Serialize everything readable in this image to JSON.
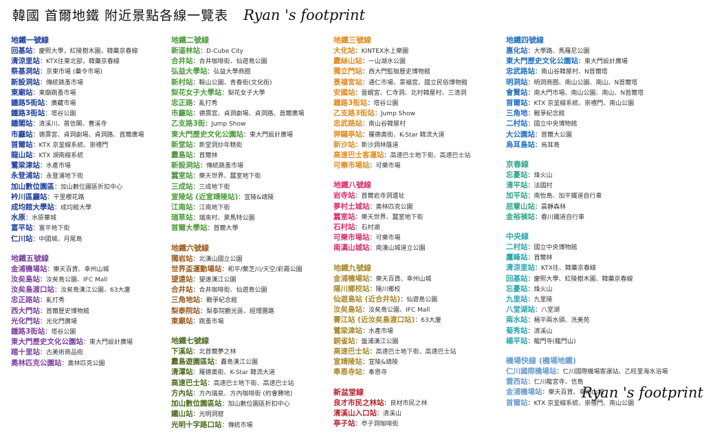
{
  "header": {
    "title": "韓國 首爾地鐵 附近景點各線一覽表",
    "signature": "Ryan 's footprint"
  },
  "footer": {
    "signature": "Ryan 's footprint"
  },
  "columns": [
    [
      {
        "title": "地鐵一號線",
        "color": "#1d3e9e",
        "items": [
          [
            "回基站",
            "慶熙大學，紅陵樹木園，韓藥京春線"
          ],
          [
            "清涼里站",
            "KTX往東北部，韓藥京春線"
          ],
          [
            "祭基洞站",
            "京東市場 (藥令市場)"
          ],
          [
            "新設洞站",
            "傳統跳蚤市場"
          ],
          [
            "東廟站",
            "東廟跳蚤市場"
          ],
          [
            "鍾路5街站",
            "廣藏市場"
          ],
          [
            "鍾路3街站",
            "塔谷公園"
          ],
          [
            "鍾閣站",
            "清溪川、普信閣、曹溪寺"
          ],
          [
            "市廳站",
            "德壽宮、貞洞劇場、貞洞路、首爾廣場"
          ],
          [
            "首爾站",
            "KTX 京釜線系統、崇禮門"
          ],
          [
            "龍山站",
            "KTX 湖南線系統"
          ],
          [
            "鷺梁津站",
            "水產市場"
          ],
          [
            "永登浦站",
            "永登浦地下街"
          ],
          [
            "加山數位園區",
            "加山數位園區折扣中心"
          ],
          [
            "衿川區廳站",
            "干里櫻花路"
          ],
          [
            "成均館大學站",
            "成均館大學"
          ],
          [
            "水原",
            "水原華城"
          ],
          [
            "富平站",
            "富平地下街"
          ],
          [
            "仁川站",
            "中國城、月尾島"
          ]
        ]
      },
      {
        "title": "地鐵五號線",
        "color": "#7b3fa0",
        "items": [
          [
            "金浦機場站",
            "樂天百貨、幸州山城"
          ],
          [
            "汝矣島站",
            "汝矣島公園、IFC Mall"
          ],
          [
            "汝矣島渡口站",
            "汝矣島漢江公園、63大廈"
          ],
          [
            "忠正路站",
            "亂打秀"
          ],
          [
            "西大門站",
            "首爾歷史博物館"
          ],
          [
            "光化門站",
            "光化門廣場"
          ],
          [
            "鍾路3街站",
            "塔谷公園"
          ],
          [
            "東大門歷史文化公園站",
            "東大門設計廣場"
          ],
          [
            "踏十里站",
            "古美術商品街"
          ],
          [
            "奧林匹克公園站",
            "奧林匹克公園"
          ]
        ]
      }
    ],
    [
      {
        "title": "地鐵二號線",
        "color": "#4a9a3a",
        "items": [
          [
            "新道林站",
            "D-Cube City"
          ],
          [
            "合井站",
            "合井咖啡街、仙遊島公園"
          ],
          [
            "弘益大學站",
            "弘益大學商圈"
          ],
          [
            "新村站",
            "鞍山公園、青春街(文化街)"
          ],
          [
            "梨花女子大學站",
            "梨花女子大學"
          ],
          [
            "忠正路",
            "亂打秀"
          ],
          [
            "市廳站",
            "德壽宮、貞洞劇場、貞洞路、首爾廣場"
          ],
          [
            "乙支路3街",
            "Jump Show"
          ],
          [
            "東大門歷史文化公園站",
            "東大門設計廣場"
          ],
          [
            "新堂站",
            "新堂洞炒年糕街"
          ],
          [
            "纛島站",
            "首爾林"
          ],
          [
            "新設洞站",
            "傳統跳蚤市場"
          ],
          [
            "蠶室站",
            "樂天世界、蠶室地下街"
          ],
          [
            "三成站",
            "三成地下街"
          ],
          [
            "宣陵站 (近宣靖陵站)",
            "宣陵&靖陵"
          ],
          [
            "江南站",
            "江南地下街"
          ],
          [
            "瑞草站",
            "瑞來村、萊馬特公園"
          ],
          [
            "首爾大學站",
            "首爾大學"
          ]
        ]
      },
      {
        "title": "地鐵六號線",
        "color": "#9a5a1a",
        "items": [
          [
            "獨岩站",
            "北漢山國立公園"
          ],
          [
            "世界盃運動場站",
            "和平/蘭芝川/天空/彩霞公園"
          ],
          [
            "望遠站",
            "望遠漢江公園"
          ],
          [
            "合井站",
            "合井咖啡街、仙遊島公園"
          ],
          [
            "三角地站",
            "戰爭紀念館"
          ],
          [
            "梨泰院站",
            "梨泰院觀光區、經理團路"
          ],
          [
            "東廟站",
            "跳蚤市場"
          ]
        ]
      },
      {
        "title": "地鐵七號線",
        "color": "#4d6b1e",
        "items": [
          [
            "下溪站",
            "北首爾夢之林"
          ],
          [
            "纛島遊園區站",
            "纛島漢江公園"
          ],
          [
            "清潭站",
            "羅德奧街、K-Star 韓流大道"
          ],
          [
            "高速巴士站",
            "高速巴士地下街、高速巴士站"
          ],
          [
            "方內站",
            "方內瑞泉、方內咖啡街 (約會勝地)"
          ],
          [
            "加山數位園區站",
            "加山數位園區折扣中心"
          ],
          [
            "鐵山站",
            "光明洞窟"
          ],
          [
            "光明十字路口站",
            "傳統市場"
          ]
        ]
      }
    ],
    [
      {
        "title": "地鐵三號線",
        "color": "#e08a1c",
        "items": [
          [
            "大化站",
            "KINTEX水上樂園"
          ],
          [
            "纛絲山站",
            "一山湖水公園"
          ],
          [
            "獨立門站",
            "西大門監獄歷史博物館"
          ],
          [
            "景福宮站",
            "通仁市場、景福宮、國立民俗博物館"
          ],
          [
            "安國站",
            "雲峴宮、仁寺洞、北村韓屋村、三清洞"
          ],
          [
            "鍾路3街站",
            "塔谷公園"
          ],
          [
            "乙支路3街站",
            "Jump Show"
          ],
          [
            "忠武路站",
            "南山谷韓屋村"
          ],
          [
            "狎鷗亭站",
            "羅德奧街、K-Star 韓流大道"
          ],
          [
            "新沙站",
            "新沙洞林蔭道"
          ],
          [
            "高速巴士客運站",
            "高速巴士地下街、高速巴士站"
          ],
          [
            "可樂市場站",
            "可樂市場"
          ]
        ]
      },
      {
        "title": "地鐵八號線",
        "color": "#d8306a",
        "items": [
          [
            "岩寺站",
            "首爾岩寺洞遺址"
          ],
          [
            "夢村土城站",
            "奧林匹克公園"
          ],
          [
            "蠶室站",
            "樂天世界、蠶室地下街"
          ],
          [
            "石村站",
            "石村湖"
          ],
          [
            "可樂市場站",
            "可樂市場"
          ],
          [
            "南漢山城站",
            "南漢山城道立公園"
          ]
        ]
      },
      {
        "title": "地鐵九號線",
        "color": "#a88a2a",
        "items": [
          [
            "金浦機場站",
            "樂天百貨、幸州山城"
          ],
          [
            "陽川鄉校站",
            "陽川鄉校"
          ],
          [
            "仙遊島站 (近合井站)",
            "仙遊島公園"
          ],
          [
            "汝矣島站",
            "汝矣島公園、IFC Mall"
          ],
          [
            "賽江站 (近汝矣島渡口站)",
            "63大廈"
          ],
          [
            "鷺梁津站",
            "水產市場"
          ],
          [
            "銅雀站",
            "盤浦漢江公園"
          ],
          [
            "高速巴士站",
            "高速巴士地下街、高速巴士站"
          ],
          [
            "宣靖陵站",
            "宣陵&靖陵"
          ],
          [
            "奉恩寺站",
            "奉恩寺"
          ]
        ]
      },
      {
        "title": "新盆堂線",
        "color": "#b8202a",
        "items": [
          [
            "良才市民之林站",
            "良材市民之林"
          ],
          [
            "清溪山入口站",
            "清溪山"
          ],
          [
            "亭子站",
            "亭子洞咖啡街"
          ]
        ]
      }
    ],
    [
      {
        "title": "地鐵四號線",
        "color": "#1f6fc2",
        "items": [
          [
            "惠化站",
            "大學路、馬羅尼公園"
          ],
          [
            "東大門歷史文化公園站",
            "東大門設計廣場"
          ],
          [
            "忠武路站",
            "南山谷韓屋村、N首爾塔"
          ],
          [
            "明洞站",
            "明洞商圈、南山公園、南山、N首爾塔"
          ],
          [
            "會賢站",
            "南大門市場、南山公園、南山、N首爾塔"
          ],
          [
            "首爾站",
            "KTX 京釜線系統、崇禮門、南山公園"
          ],
          [
            "三角地",
            "戰爭紀念館"
          ],
          [
            "二村站",
            "國立中央博物館"
          ],
          [
            "大公園站",
            "首爾大公園"
          ],
          [
            "烏耳島站",
            "烏耳島"
          ]
        ]
      },
      {
        "title": "京春線",
        "color": "#2fa58a",
        "items": [
          [
            "忘憂站",
            "烽火山"
          ],
          [
            "清平站",
            "法國村"
          ],
          [
            "加平站",
            "南怡島、加平鐵道自行車"
          ],
          [
            "屈輩山站",
            "晨靜森林"
          ],
          [
            "金裕禎站",
            "春川鐵道自行車"
          ]
        ]
      },
      {
        "title": "中央線",
        "color": "#29a6b0",
        "items": [
          [
            "二村站",
            "國立中央博物館"
          ],
          [
            "鷹峰站",
            "首爾林"
          ],
          [
            "清涼里站",
            "KTX往、韓藥京春線"
          ],
          [
            "回基站",
            "慶熙大學、紅陵樹木園、韓藥京春線"
          ],
          [
            "忘憂站",
            "烽火山"
          ],
          [
            "九里站",
            "九里陵"
          ],
          [
            "八堂湖站",
            "八堂湖"
          ],
          [
            "兩水站",
            "楊平兩水頭、洗美苑"
          ],
          [
            "菊秀站",
            "清溪山"
          ],
          [
            "楊平站",
            "龍門寺(龍門山)"
          ]
        ]
      },
      {
        "title": "機場快線 (機場地鐵)",
        "color": "#6a9ccf",
        "items": [
          [
            "仁川國際機場站",
            "仁川國際機場客運站、乙旺里海水浴場"
          ],
          [
            "雲西站",
            "仁川龍宮寺、信島"
          ],
          [
            "金浦機場站",
            "樂天百貨、幸州山城"
          ],
          [
            "首爾站",
            "KTX 京釜線系統、崇禮門、南山公園"
          ]
        ]
      }
    ]
  ]
}
